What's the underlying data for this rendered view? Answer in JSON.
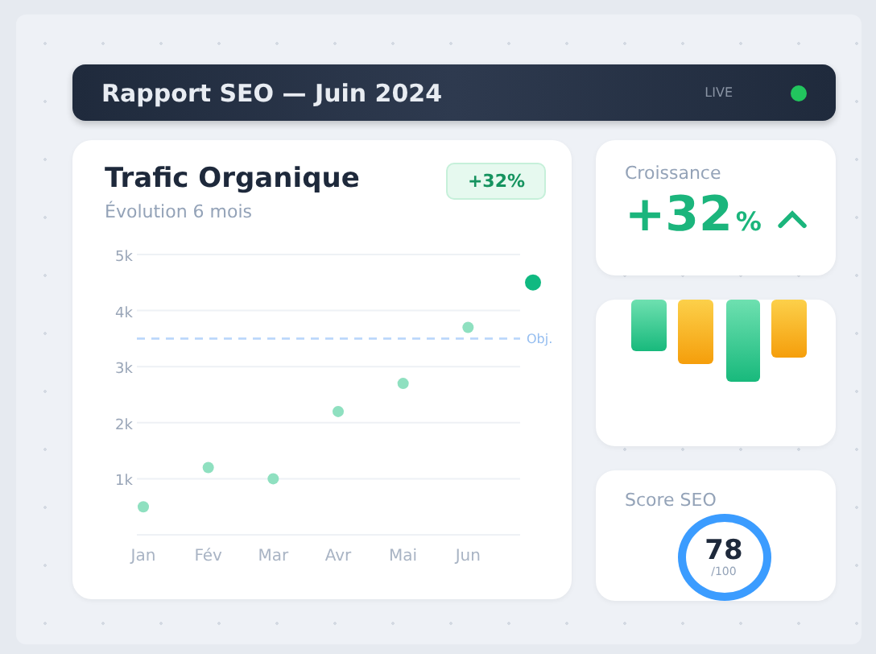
{
  "header": {
    "title": "Rapport SEO — Juin 2024",
    "status": "LIVE",
    "live": true
  },
  "traffic": {
    "title": "Trafic Organique",
    "subtitle": "Évolution 6 mois",
    "badge": "+32%",
    "chart_data": {
      "type": "scatter",
      "categories": [
        "Jan",
        "Fév",
        "Mar",
        "Avr",
        "Mai",
        "Jun",
        null
      ],
      "ylim": [
        0,
        5000
      ],
      "yticks": [
        {
          "value": 1000,
          "label": "1k"
        },
        {
          "value": 2000,
          "label": "2k"
        },
        {
          "value": 3000,
          "label": "3k"
        },
        {
          "value": 4000,
          "label": "4k"
        },
        {
          "value": 5000,
          "label": "5k"
        }
      ],
      "series": [
        {
          "color": "#8fe0c0",
          "values": [
            500,
            1200,
            1000,
            2200,
            2700,
            3700,
            null
          ]
        },
        {
          "color": "#10b981",
          "values": [
            null,
            null,
            null,
            null,
            null,
            null,
            4500
          ]
        }
      ],
      "ref_lines": [
        {
          "axis": "y",
          "value": 3500,
          "label": "Obj."
        }
      ],
      "grid": true
    }
  },
  "growth": {
    "label": "Croissance",
    "value": "+32",
    "unit": "%",
    "trend_up": true
  },
  "score": {
    "label": "Score SEO",
    "value": "78",
    "max": "/100"
  }
}
